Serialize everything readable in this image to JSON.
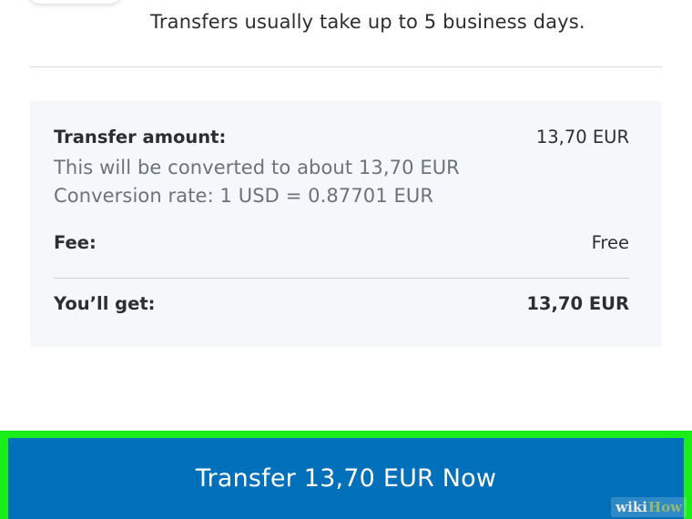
{
  "header": {
    "transfer_note": "Transfers usually take up to 5 business days."
  },
  "summary": {
    "transfer_amount_label": "Transfer amount:",
    "transfer_amount_value": "13,70 EUR",
    "conversion_note": "This will be converted to about 13,70 EUR",
    "conversion_rate": "Conversion rate: 1 USD = 0.87701 EUR",
    "fee_label": "Fee:",
    "fee_value": "Free",
    "you_get_label": "You’ll get:",
    "you_get_value": "13,70 EUR"
  },
  "actions": {
    "transfer_button_label": "Transfer 13,70 EUR Now"
  },
  "watermark": {
    "wiki": "wiki",
    "how": "How"
  },
  "colors": {
    "button": "#0070ba",
    "highlight": "#19ee19",
    "card_background": "#f5f7fa"
  }
}
